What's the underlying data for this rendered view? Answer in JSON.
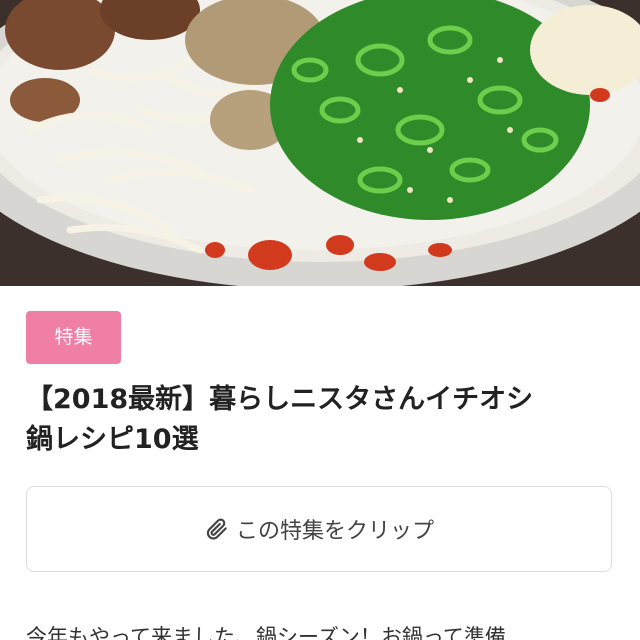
{
  "hero": {
    "image": "hotpot-photo"
  },
  "article": {
    "tag": "特集",
    "title_line1": "【2018最新】暮らしニスタさんイチオシ",
    "title_line2": "鍋レシピ10選",
    "clip_label": "この特集をクリップ",
    "clip_icon": "paperclip-icon",
    "intro": "今年もやって来ました、鍋シーズン！お鍋って準備"
  },
  "colors": {
    "tag_bg": "#ef7fa5",
    "tag_text": "#ffffff",
    "title_text": "#222222",
    "button_border": "#dcdcdc"
  }
}
